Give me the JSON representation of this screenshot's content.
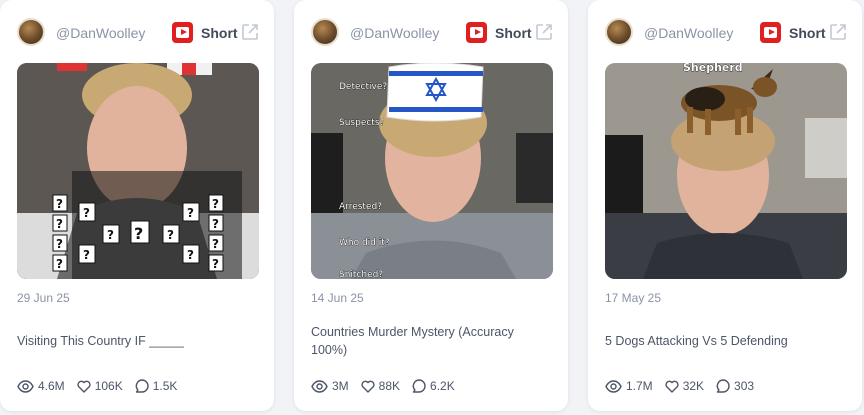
{
  "cards": [
    {
      "handle": "@DanWoolley",
      "type_label": "Short",
      "date": "29 Jun 25",
      "title": "Visiting This Country IF _____",
      "views": "4.6M",
      "likes": "106K",
      "comments": "1.5K"
    },
    {
      "handle": "@DanWoolley",
      "type_label": "Short",
      "date": "14 Jun 25",
      "title": "Countries Murder Mystery (Accuracy 100%)",
      "views": "3M",
      "likes": "88K",
      "comments": "6.2K",
      "overlay_text": [
        "Detective?",
        "Suspects?",
        "Arrested?",
        "Who did it?",
        "Snitched?"
      ]
    },
    {
      "handle": "@DanWoolley",
      "type_label": "Short",
      "date": "17 May 25",
      "title": "5 Dogs Attacking Vs 5 Defending",
      "views": "1.7M",
      "likes": "32K",
      "comments": "303",
      "overlay_text": [
        "Shepherd"
      ]
    }
  ],
  "icons": {
    "platform": "youtube-icon",
    "external": "external-link-icon",
    "views": "eye-icon",
    "likes": "heart-icon",
    "comments": "comment-icon"
  },
  "colors": {
    "youtube_red": "#e02020",
    "muted_text": "#8a93a6",
    "body_text": "#4d5567"
  }
}
